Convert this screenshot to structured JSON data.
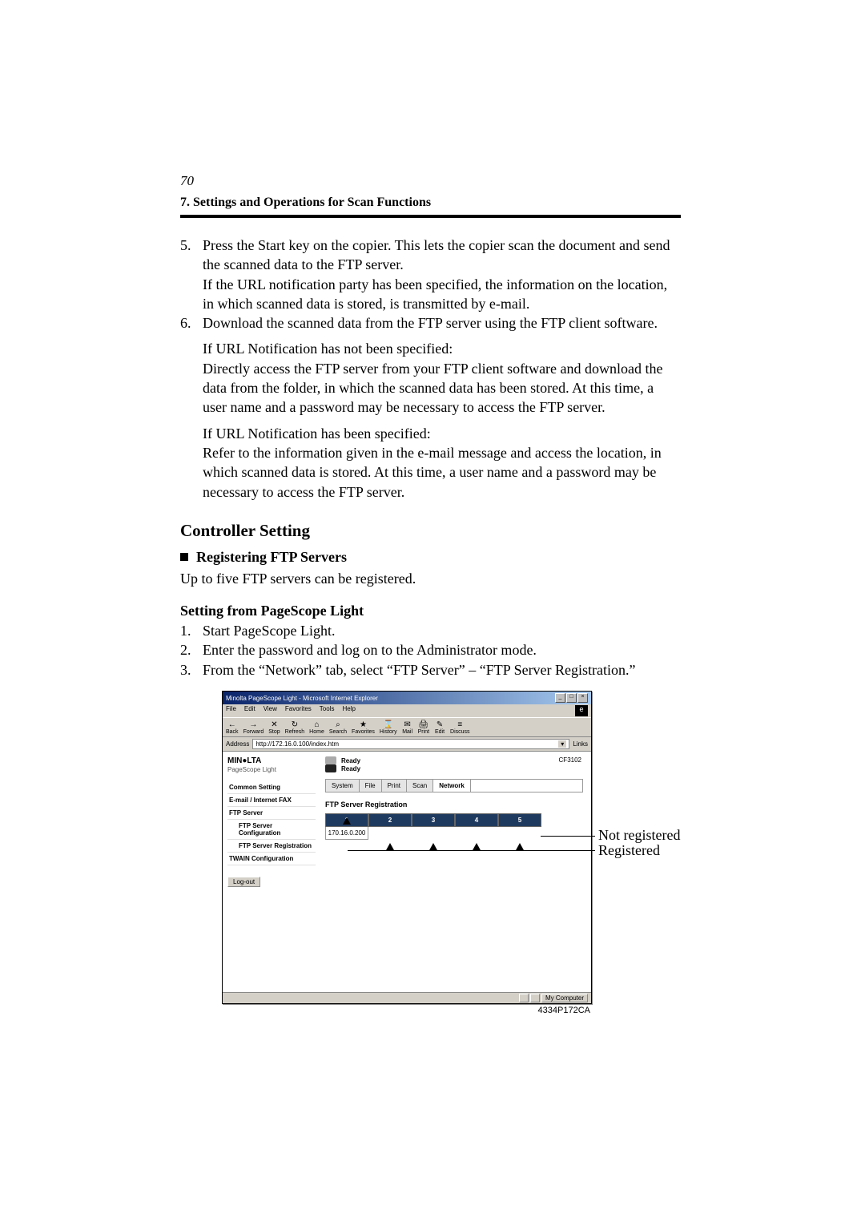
{
  "page_number": "70",
  "header": "7. Settings and Operations for Scan Functions",
  "steps_a": [
    {
      "num": "5.",
      "text": "Press the Start key on the copier.  This lets the copier scan the document and send the scanned data to the FTP server.\nIf the URL notification party has been specified, the information on the location, in which scanned data is stored, is transmitted by e-mail."
    },
    {
      "num": "6.",
      "text": "Download the scanned data from the FTP server using the FTP client software."
    }
  ],
  "cond1_title": "If URL Notification has not been specified:",
  "cond1_body": "Directly access the FTP server from your FTP client software and download the data from the folder, in which the scanned data has been stored.  At this time, a user name and a password may be necessary to access the FTP server.",
  "cond2_title": "If URL Notification has been specified:",
  "cond2_body": "Refer to the information given in the e-mail message and access the location, in which scanned data is stored.  At this time, a user name and a password may be necessary to access the FTP server.",
  "h2": "Controller Setting",
  "h3": "Registering FTP Servers",
  "h3_sub": "Up to five FTP servers can be registered.",
  "h4": "Setting from PageScope Light",
  "steps_b": [
    {
      "num": "1.",
      "text": "Start PageScope Light."
    },
    {
      "num": "2.",
      "text": "Enter the password and log on to the Administrator mode."
    },
    {
      "num": "3.",
      "text": "From the “Network” tab, select “FTP Server” – “FTP Server Registration.”"
    }
  ],
  "ie": {
    "title": "Minolta PageScope Light - Microsoft Internet Explorer",
    "menu": [
      "File",
      "Edit",
      "View",
      "Favorites",
      "Tools",
      "Help"
    ],
    "toolbar": [
      {
        "label": "Back",
        "icon": "←"
      },
      {
        "label": "Forward",
        "icon": "→"
      },
      {
        "label": "Stop",
        "icon": "✕"
      },
      {
        "label": "Refresh",
        "icon": "↻"
      },
      {
        "label": "Home",
        "icon": "⌂"
      },
      {
        "label": "Search",
        "icon": "⌕"
      },
      {
        "label": "Favorites",
        "icon": "★"
      },
      {
        "label": "History",
        "icon": "⌛"
      },
      {
        "label": "Mail",
        "icon": "✉"
      },
      {
        "label": "Print",
        "icon": "🖨"
      },
      {
        "label": "Edit",
        "icon": "✎"
      },
      {
        "label": "Discuss",
        "icon": "≡"
      }
    ],
    "address_label": "Address",
    "address_value": "http://172.16.0.100/index.htm",
    "links_label": "Links",
    "brand": "MIN●LTA",
    "brand_sub": "PageScope Light",
    "sidebar": [
      {
        "label": "Common Setting",
        "cls": "sb-bold"
      },
      {
        "label": "E-mail / Internet FAX",
        "cls": "sb-bold"
      },
      {
        "label": "FTP Server",
        "cls": "sb-bold"
      },
      {
        "label": "FTP Server Configuration",
        "cls": "sb-indent"
      },
      {
        "label": "FTP Server Registration",
        "cls": "sb-indent"
      },
      {
        "label": "TWAIN Configuration",
        "cls": "sb-bold"
      }
    ],
    "logout": "Log-out",
    "ready": "Ready",
    "model": "CF3102",
    "tabs": [
      "System",
      "File",
      "Print",
      "Scan",
      "Network"
    ],
    "section_title": "FTP Server Registration",
    "reg_tabs": [
      "1",
      "2",
      "3",
      "4",
      "5"
    ],
    "reg_value": "170.16.0.200",
    "statusbar": "My Computer"
  },
  "callout_not_registered": "Not registered",
  "callout_registered": "Registered",
  "image_code": "4334P172CA"
}
